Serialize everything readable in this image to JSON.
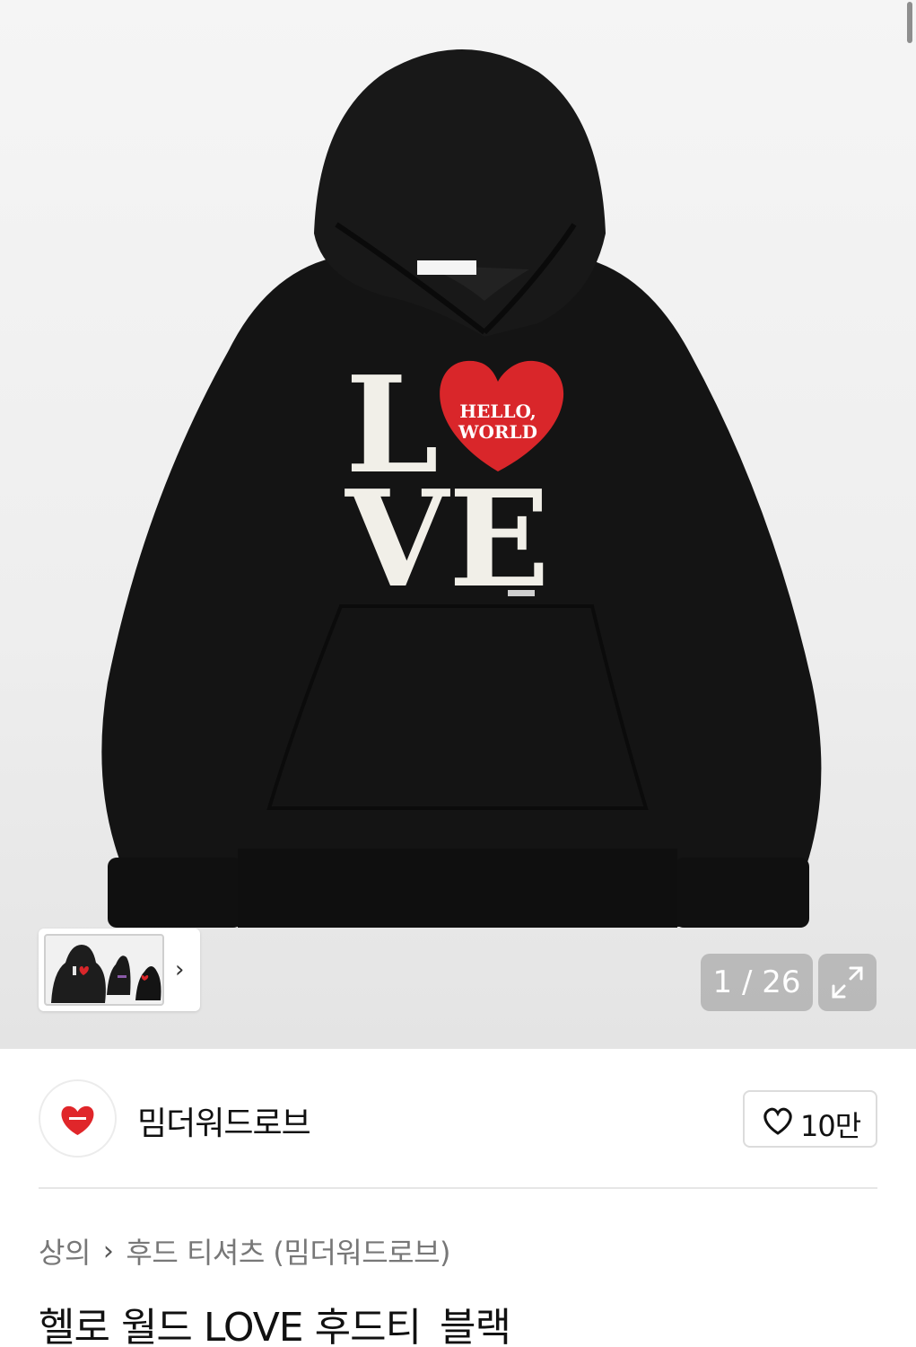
{
  "gallery": {
    "counter": "1 / 26",
    "print_line1": "HELLO,",
    "print_line2": "WORLD",
    "print_letters": [
      "L",
      "V",
      "E"
    ],
    "hoodie_color": "#111111",
    "heart_color": "#d9262a"
  },
  "brand": {
    "name": "밈더워드로브",
    "logo_icon": "heart-logo",
    "likes": "10만"
  },
  "breadcrumb": {
    "category": "상의",
    "subcategory": "후드 티셔츠 (밈더워드로브)"
  },
  "product": {
    "title": "헬로 월드 LOVE 후드티_블랙"
  }
}
